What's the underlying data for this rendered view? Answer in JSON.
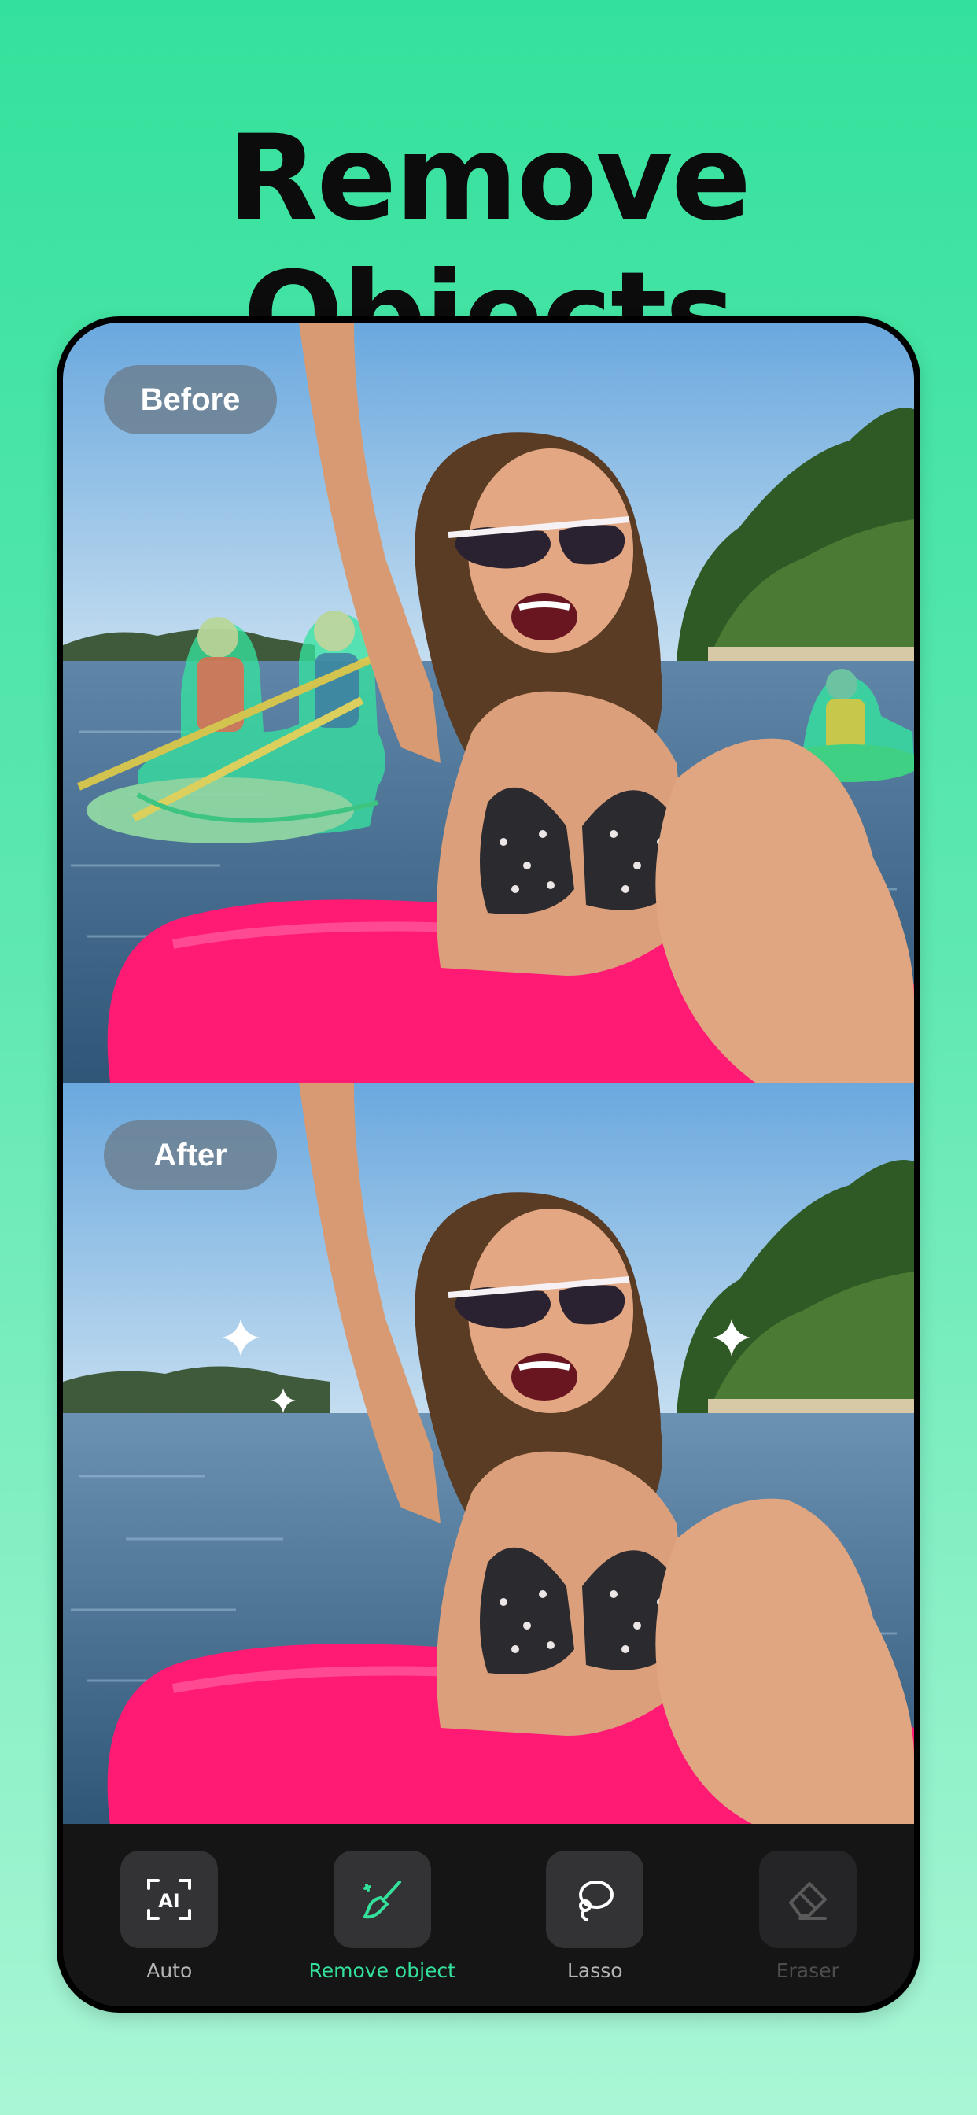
{
  "headline": "Remove Objects",
  "before_label": "Before",
  "after_label": "After",
  "toolbar": {
    "tools": [
      {
        "label": "Auto",
        "icon": "ai-auto-icon",
        "state": "normal"
      },
      {
        "label": "Remove object",
        "icon": "brush-icon",
        "state": "active"
      },
      {
        "label": "Lasso",
        "icon": "lasso-icon",
        "state": "normal"
      },
      {
        "label": "Eraser",
        "icon": "eraser-icon",
        "state": "disabled"
      }
    ]
  },
  "colors": {
    "background_top": "#34e19c",
    "background_bottom": "#a9f6d5",
    "accent": "#34e19c",
    "selection_mask": "#35e39f",
    "float_pink": "#ff1a74"
  }
}
